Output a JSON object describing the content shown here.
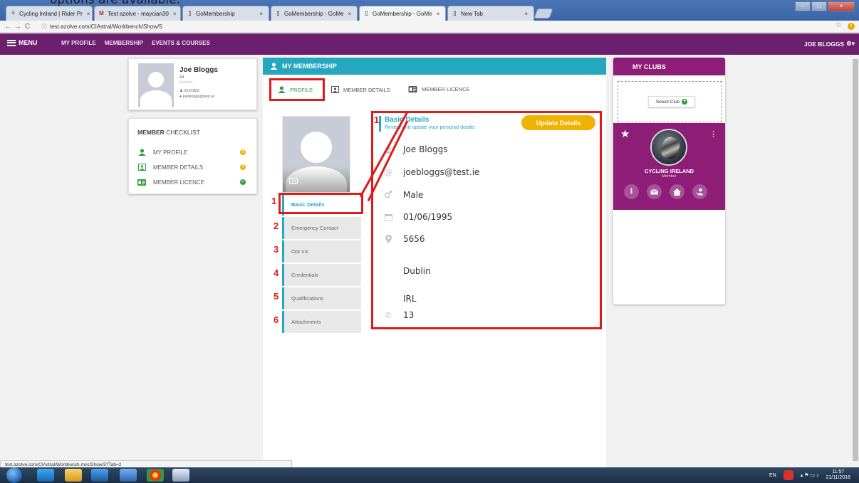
{
  "caption": "options are available:",
  "browser": {
    "tabs": [
      {
        "title": "Cycling Ireland | Rider Pr",
        "icon": "cycling-ireland-icon"
      },
      {
        "title": "Test azolve - maycian30",
        "icon": "gmail-icon"
      },
      {
        "title": "GoMembership",
        "icon": "page-icon"
      },
      {
        "title": "GoMembership - GoMe",
        "icon": "page-icon"
      },
      {
        "title": "GoMembership - GoMe",
        "icon": "page-icon",
        "active": true
      },
      {
        "title": "New Tab",
        "icon": "page-icon"
      }
    ],
    "url": "test.azolve.com/CIAstral/Workbench/Show/5"
  },
  "nav": {
    "menu_label": "MENU",
    "links": [
      "MY PROFILE",
      "MEMBERSHIP",
      "EVENTS & COURSES"
    ],
    "user": "JOE BLOGGS"
  },
  "profile_card": {
    "name": "Joe Bloggs",
    "code": "A4",
    "expires": "Expires -",
    "member_id": "0231833",
    "email": "joebloggs@test.ie"
  },
  "checklist": {
    "title_bold": "MEMBER",
    "title_rest": " CHECKLIST",
    "items": [
      {
        "label": "MY PROFILE",
        "status": "warning"
      },
      {
        "label": "MEMBER DETAILS",
        "status": "warning"
      },
      {
        "label": "MEMBER LICENCE",
        "status": "complete"
      }
    ]
  },
  "membership": {
    "title": "MY MEMBERSHIP",
    "tabs": [
      "PROFILE",
      "MEMBER DETAILS",
      "MEMBER LICENCE"
    ],
    "side_tabs": [
      {
        "num": "1",
        "label": "Basic Details"
      },
      {
        "num": "2",
        "label": "Emergency Contact"
      },
      {
        "num": "3",
        "label": "Opt Ins"
      },
      {
        "num": "4",
        "label": "Credentials"
      },
      {
        "num": "5",
        "label": "Qualifications"
      },
      {
        "num": "6",
        "label": "Attachments"
      }
    ],
    "details": {
      "anno_num": "1",
      "title": "Basic Details",
      "subtitle": "Review and update your personal details",
      "update_label": "Update Details",
      "name": "Joe Bloggs",
      "email": "joebloggs@test.ie",
      "gender": "Male",
      "dob": "01/06/1995",
      "address1": "5656",
      "city": "Dublin",
      "country": "IRL",
      "phone": "13"
    }
  },
  "clubs": {
    "title": "MY CLUBS",
    "select_label": "Select Club",
    "club_name": "CYCLING IRELAND",
    "club_role": "Member"
  },
  "status_url": "test.azolve.com/CIAstral/Workbench.mvc/Show/5?Tab=2",
  "tray": {
    "lang": "EN",
    "time": "11:57",
    "date": "21/11/2016"
  },
  "colors": {
    "nav": "#6b1f6d",
    "teal": "#25a7c0",
    "club": "#8e1d78",
    "accent": "#f0b400",
    "annotation": "#e01a1a"
  }
}
